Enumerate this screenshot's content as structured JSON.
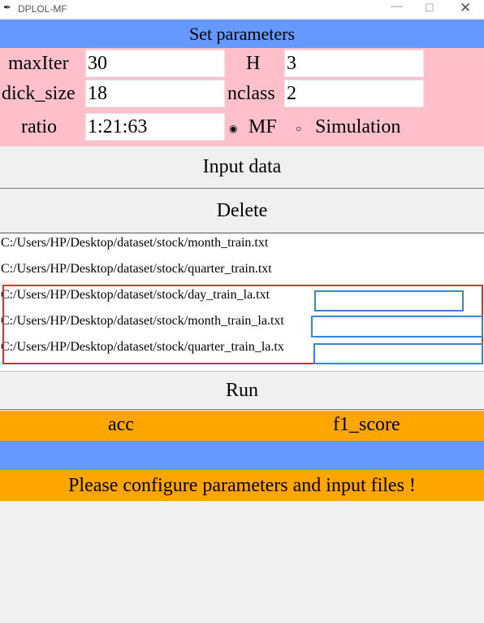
{
  "window": {
    "title": "DPLOL-MF",
    "controls": {
      "minimize": "—",
      "maximize": "☐",
      "close": "✕"
    }
  },
  "header": {
    "title": "Set parameters"
  },
  "params": {
    "maxIter": {
      "label": "maxIter",
      "value": "30"
    },
    "H": {
      "label": "H",
      "value": "3"
    },
    "dick_size": {
      "label": "dick_size",
      "value": "18"
    },
    "nclass": {
      "label": "nclass",
      "value": "2"
    },
    "ratio": {
      "label": "ratio",
      "value": "1:21:63"
    },
    "mode": {
      "options": [
        "MF",
        "Simulation"
      ],
      "selected": "MF"
    }
  },
  "buttons": {
    "input_data": "Input data",
    "delete": "Delete",
    "run": "Run"
  },
  "files": [
    {
      "prefix": "C:/Users/HP/Desktop/dataset/stock/",
      "name": "month_train.txt"
    },
    {
      "prefix": "C:/Users/HP/Desktop/dataset/stock/",
      "name": "quarter_train.txt"
    },
    {
      "prefix": "C:/Users/HP/Desktop/dataset/stock/",
      "name": "day_train_la.txt"
    },
    {
      "prefix": "C:/Users/HP/Desktop/dataset/stock/",
      "name": "month_train_la.txt"
    },
    {
      "prefix": "C:/Users/HP/Desktop/dataset/stock/",
      "name": "quarter_train_la.tx"
    }
  ],
  "metrics": {
    "acc_label": "acc",
    "f1_label": "f1_score"
  },
  "status": {
    "message": "Please configure parameters and input files !"
  },
  "colors": {
    "header_bg": "#6699ff",
    "params_bg": "#ffc0cb",
    "metrics_bg": "#ffa500",
    "highlight_red": "#e03030",
    "highlight_blue": "#3388dd"
  }
}
